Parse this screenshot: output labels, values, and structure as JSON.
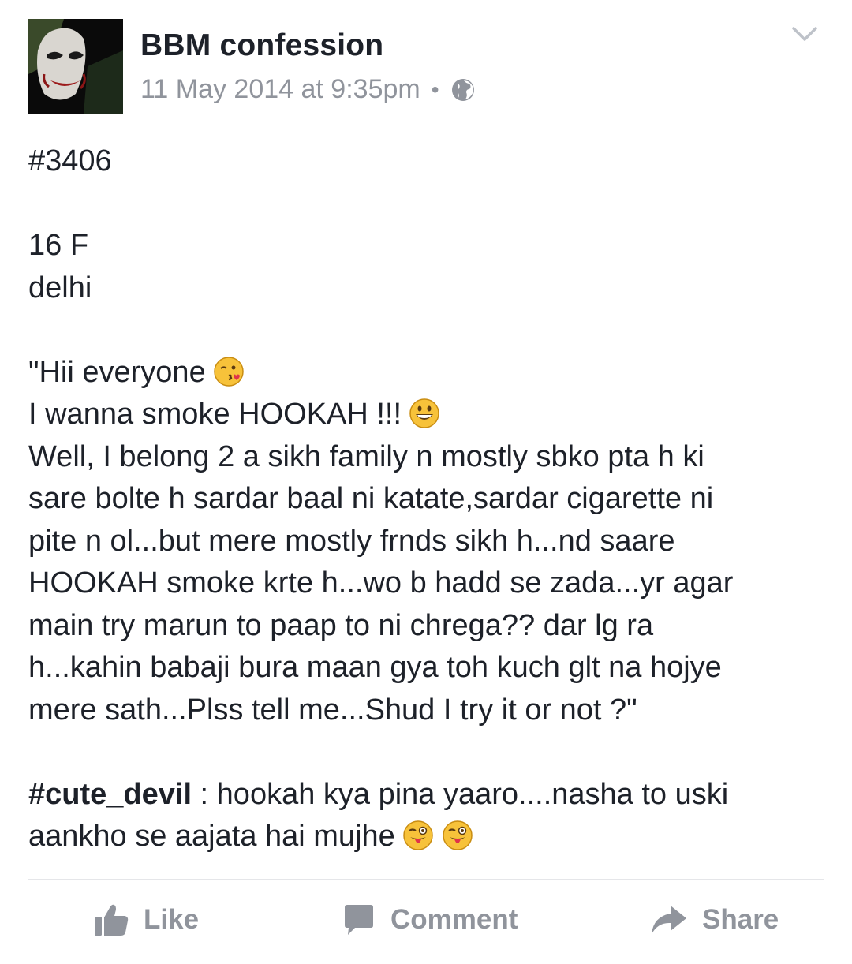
{
  "post": {
    "page_name": "BBM confession",
    "timestamp": "11 May 2014 at 9:35pm",
    "separator": "•",
    "privacy_icon": "globe-icon",
    "menu_icon": "chevron-down-icon",
    "lines": {
      "l1": "#3406",
      "l2": "16 F",
      "l3": "delhi",
      "l4": "\"Hii everyone",
      "l5": "I wanna smoke HOOKAH !!!",
      "l6": "Well, I belong 2 a sikh family n mostly sbko pta h ki",
      "l7": "sare bolte h sardar baal ni katate,sardar cigarette ni",
      "l8": "pite n ol...but mere mostly frnds sikh h...nd saare",
      "l9": "HOOKAH smoke krte h...wo b hadd se zada...yr agar",
      "l10": "main try marun to paap to ni chrega?? dar lg ra",
      "l11": "h...kahin babaji bura maan gya toh kuch glt na hojye",
      "l12": "mere sath...Plss tell me...Shud I try it or not ?\""
    },
    "comment": {
      "author": "#cute_devil",
      "text_part1": " : hookah kya pina yaaro....nasha to uski",
      "text_part2": "aankho se aajata hai mujhe"
    },
    "emojis": {
      "kiss": "kissing-wink-emoji",
      "grin": "grinning-emoji",
      "tongue": "tongue-wink-emoji"
    }
  },
  "actions": {
    "like_label": "Like",
    "comment_label": "Comment",
    "share_label": "Share"
  },
  "colors": {
    "text": "#1d2129",
    "muted": "#90949c",
    "divider": "#e5e6e9",
    "emoji_face": "#f7c23a"
  }
}
